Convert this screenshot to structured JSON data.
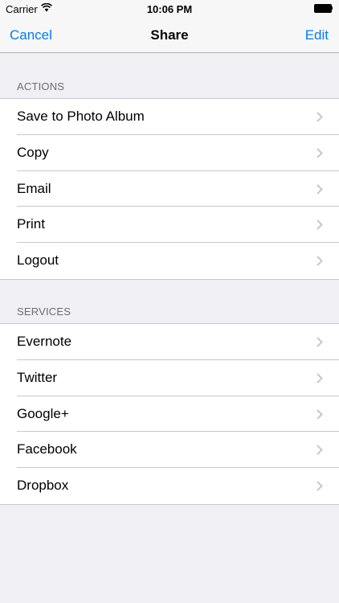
{
  "status_bar": {
    "carrier": "Carrier",
    "time": "10:06 PM",
    "wifi_icon": "wifi-icon",
    "battery_icon": "battery-icon"
  },
  "nav": {
    "cancel": "Cancel",
    "title": "Share",
    "edit": "Edit"
  },
  "actions": {
    "header": "ACTIONS",
    "items": [
      {
        "label": "Save to Photo Album"
      },
      {
        "label": "Copy"
      },
      {
        "label": "Email"
      },
      {
        "label": "Print"
      },
      {
        "label": "Logout"
      }
    ]
  },
  "services": {
    "header": "SERVICES",
    "items": [
      {
        "label": "Evernote"
      },
      {
        "label": "Twitter"
      },
      {
        "label": "Google+"
      },
      {
        "label": "Facebook"
      },
      {
        "label": "Dropbox"
      }
    ]
  },
  "colors": {
    "accent": "#007aff",
    "background": "#efeff4",
    "chevron": "#c7c7cc",
    "section_header": "#6d6d72"
  }
}
